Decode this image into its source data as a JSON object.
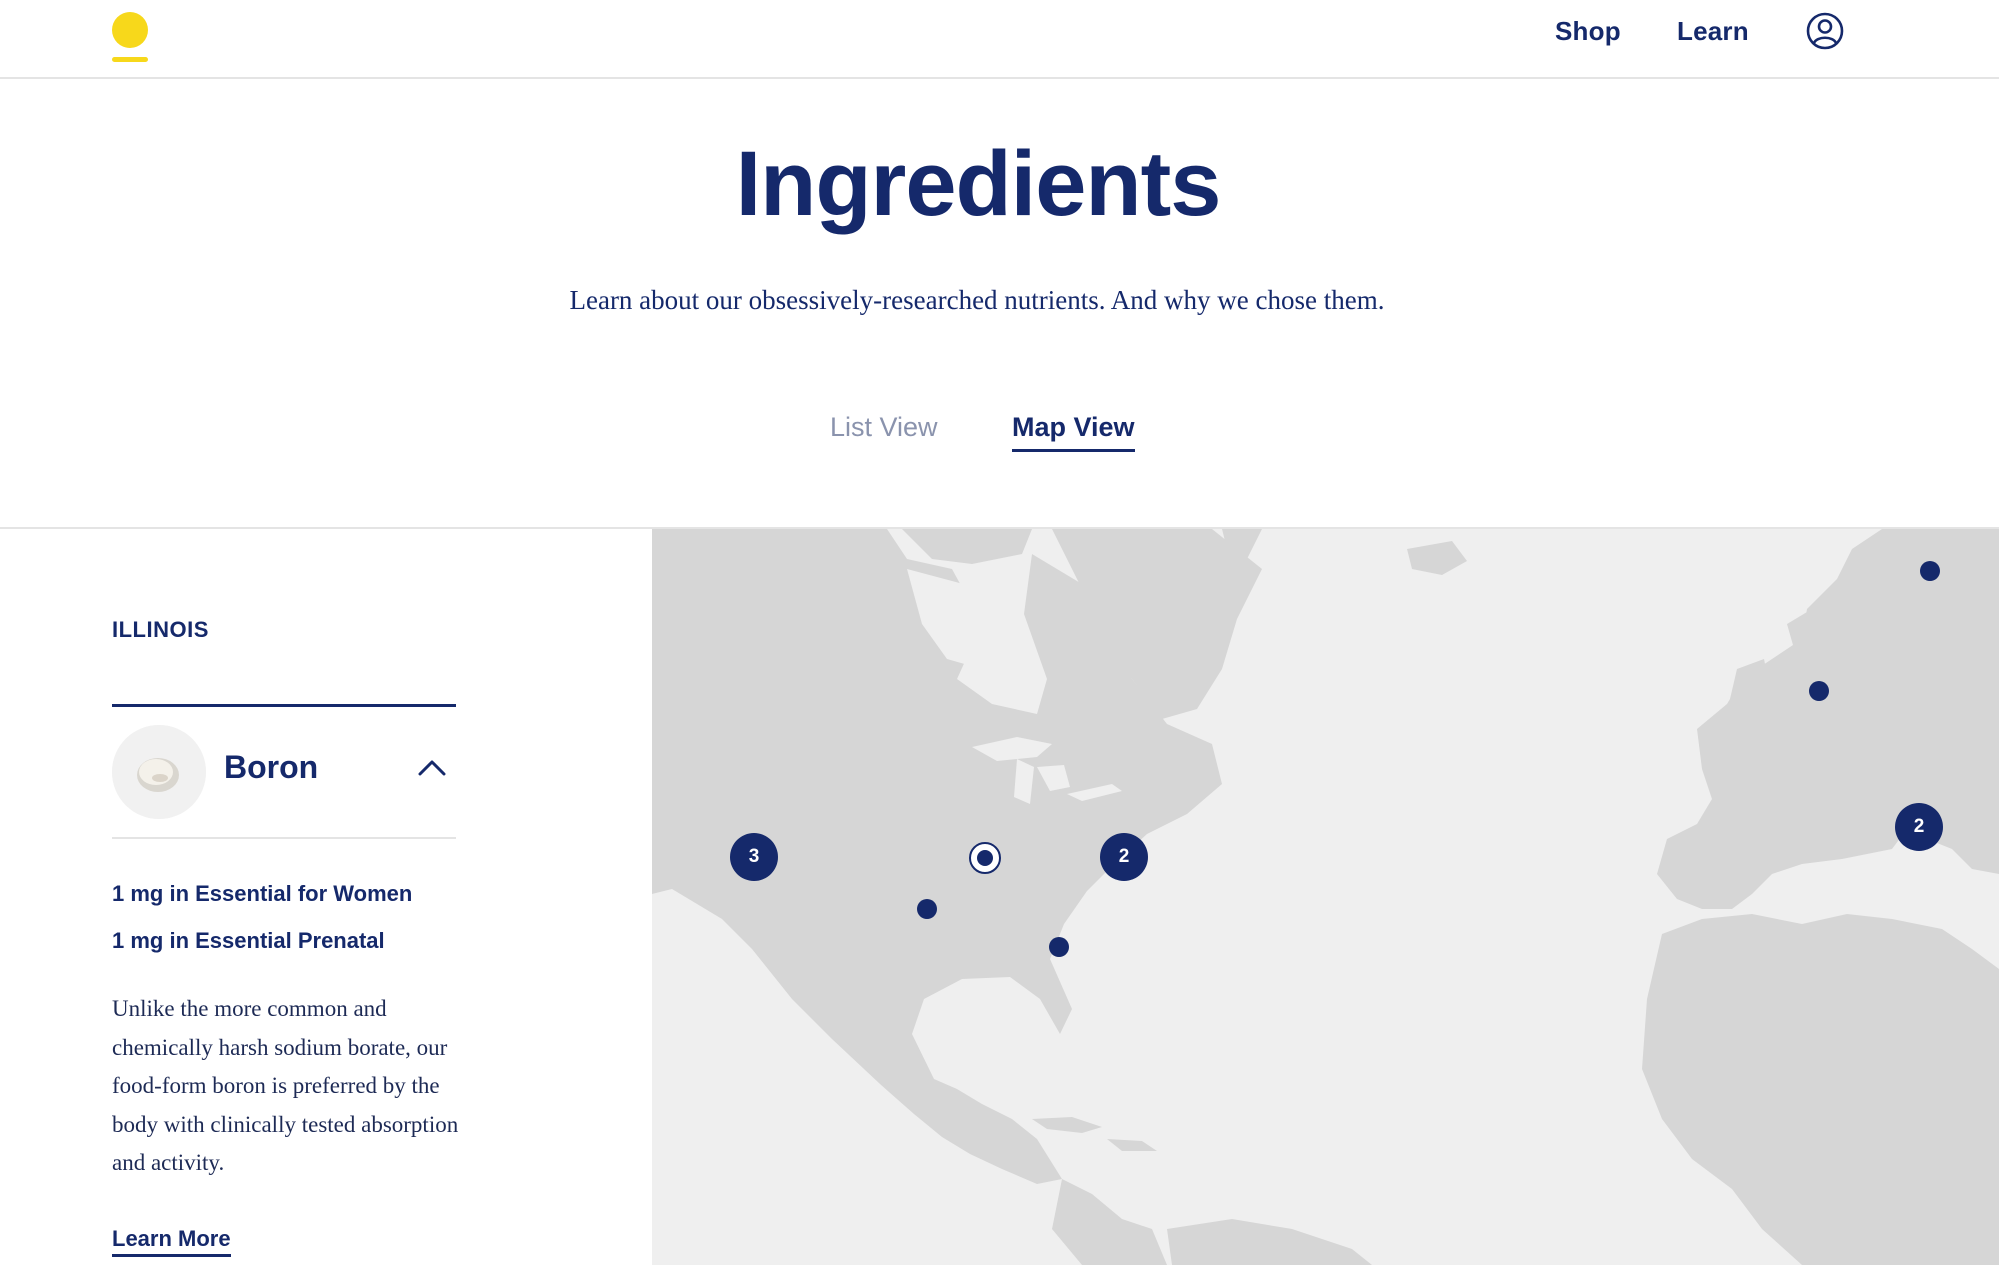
{
  "header": {
    "logo": "sun-logo",
    "nav": {
      "shop": "Shop",
      "learn": "Learn"
    },
    "account_icon": "user-circle-icon"
  },
  "hero": {
    "title": "Ingredients",
    "subtitle": "Learn about our obsessively-researched nutrients. And why we chose them."
  },
  "tabs": {
    "list": "List View",
    "map": "Map View",
    "active": "Map View"
  },
  "panel": {
    "region": "ILLINOIS",
    "ingredient": {
      "name": "Boron",
      "expanded": true,
      "doses": [
        "1 mg in Essential for Women",
        "1 mg in Essential Prenatal"
      ],
      "description": "Unlike the more common and chemically harsh sodium borate, our food-form boron is preferred by the body with clinically tested absorption and activity.",
      "learn_more": "Learn More"
    }
  },
  "map": {
    "clusters": {
      "west_us": "3",
      "east_us": "2",
      "italy": "2"
    },
    "colors": {
      "land": "#d6d6d6",
      "water": "#efefef",
      "pin": "#15296b"
    }
  },
  "colors": {
    "brand_navy": "#15296b",
    "logo_yellow": "#f7d81b",
    "muted": "#8a93ad"
  }
}
